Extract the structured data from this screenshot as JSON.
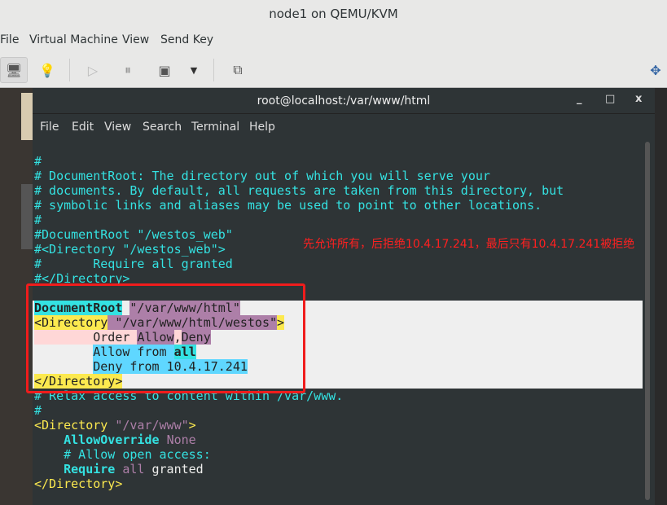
{
  "window": {
    "title": "node1 on QEMU/KVM"
  },
  "menu": [
    "File",
    "Virtual Machine",
    "View",
    "Send Key"
  ],
  "toolbar": {
    "icons": [
      "monitor-icon",
      "lightbulb-icon",
      "play-icon",
      "pause-icon",
      "power-icon",
      "dropdown-icon",
      "snapshot-icon",
      "resize-icon"
    ]
  },
  "terminal": {
    "title": "root@localhost:/var/www/html",
    "controls": {
      "minimize": "_",
      "maximize": "□",
      "close": "x"
    },
    "menu": [
      "File",
      "Edit",
      "View",
      "Search",
      "Terminal",
      "Help"
    ],
    "colors": {
      "comment": "#34e2e2",
      "tag": "#fce94f",
      "keyword": "#34e2e2",
      "value": "#ad7fa8",
      "text": "#eeeeec",
      "hl_bg": "#efefef"
    },
    "lines": [
      [
        {
          "t": "#",
          "c": "comment"
        }
      ],
      [
        {
          "t": "# DocumentRoot: The directory out of which you will serve your",
          "c": "comment"
        }
      ],
      [
        {
          "t": "# documents. By default, all requests are taken from this directory, but",
          "c": "comment"
        }
      ],
      [
        {
          "t": "# symbolic links and aliases may be used to point to other locations.",
          "c": "comment"
        }
      ],
      [
        {
          "t": "#",
          "c": "comment"
        }
      ],
      [
        {
          "t": "#DocumentRoot \"/westos_web\"",
          "c": "comment"
        }
      ],
      [
        {
          "t": "#<Directory \"/westos_web\">",
          "c": "comment"
        }
      ],
      [
        {
          "t": "#       Require all granted",
          "c": "comment"
        }
      ],
      [
        {
          "t": "#</Directory>",
          "c": "comment"
        }
      ],
      [
        {
          "t": "",
          "c": "text"
        }
      ],
      [
        {
          "t": "DocumentRoot",
          "c": "h-cyan b"
        },
        {
          "t": " ",
          "c": "h-none"
        },
        {
          "t": "\"/var/www/html\"",
          "c": "h-purple"
        }
      ],
      [
        {
          "t": "<Directory",
          "c": "h-yellow"
        },
        {
          "t": " \"/var/www/html/westos\"",
          "c": "h-purple"
        },
        {
          "t": ">",
          "c": "h-yellow"
        }
      ],
      [
        {
          "t": "        Order ",
          "c": "h-pink"
        },
        {
          "t": "Allow",
          "c": "h-purple"
        },
        {
          "t": ",",
          "c": "h-pink"
        },
        {
          "t": "Deny",
          "c": "h-purple"
        }
      ],
      [
        {
          "t": "        ",
          "c": "h-none"
        },
        {
          "t": "Allow from ",
          "c": "h-blue"
        },
        {
          "t": "all",
          "c": "h-cyan b"
        }
      ],
      [
        {
          "t": "        ",
          "c": "h-none"
        },
        {
          "t": "Deny from 10.4.17.241",
          "c": "h-blue"
        }
      ],
      [
        {
          "t": "</Directory>",
          "c": "h-yellow"
        }
      ],
      [
        {
          "t": "# Relax access to content within /var/www.",
          "c": "comment"
        }
      ],
      [
        {
          "t": "#",
          "c": "comment"
        }
      ],
      [
        {
          "t": "<Directory ",
          "c": "tag"
        },
        {
          "t": "\"/var/www\"",
          "c": "value"
        },
        {
          "t": ">",
          "c": "tag"
        }
      ],
      [
        {
          "t": "    ",
          "c": "text"
        },
        {
          "t": "AllowOverride",
          "c": "keyword b"
        },
        {
          "t": " ",
          "c": "text"
        },
        {
          "t": "None",
          "c": "value"
        }
      ],
      [
        {
          "t": "    # Allow open access:",
          "c": "comment"
        }
      ],
      [
        {
          "t": "    ",
          "c": "text"
        },
        {
          "t": "Require",
          "c": "keyword b"
        },
        {
          "t": " ",
          "c": "text"
        },
        {
          "t": "all",
          "c": "value"
        },
        {
          "t": " granted",
          "c": "text"
        }
      ],
      [
        {
          "t": "</Directory>",
          "c": "tag"
        }
      ]
    ]
  },
  "annotation": {
    "text": "先允许所有，后拒绝10.4.17.241，最后只有10.4.17.241被拒绝",
    "color": "#ff2020"
  }
}
